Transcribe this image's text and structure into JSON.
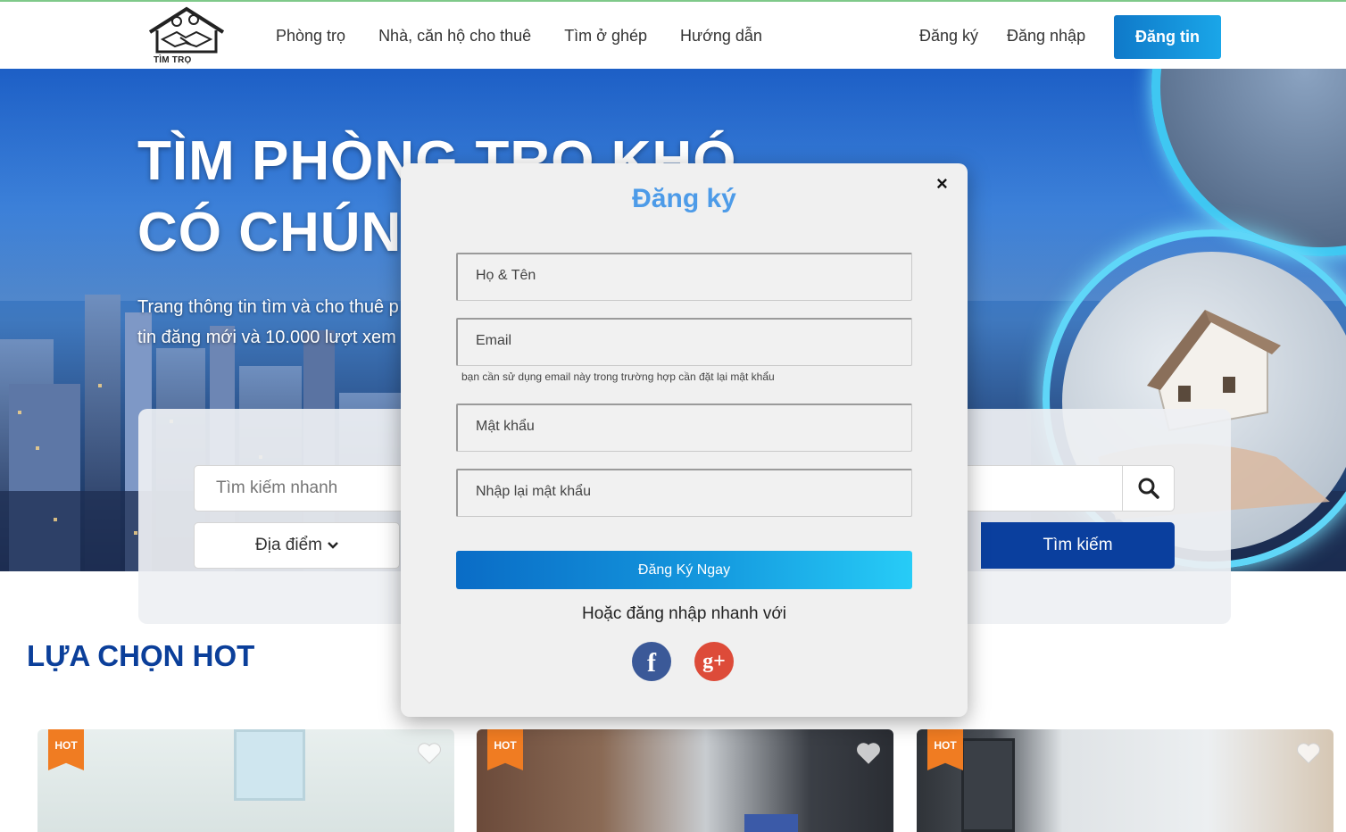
{
  "header": {
    "logo_text": "TÌM TRỌ",
    "nav": [
      "Phòng trọ",
      "Nhà, căn hộ cho thuê",
      "Tìm ở ghép",
      "Hướng dẫn"
    ],
    "register_link": "Đăng ký",
    "login_link": "Đăng nhập",
    "post_button": "Đăng tin"
  },
  "hero": {
    "title_line1": "TÌM PHÒNG TRỌ KHÓ",
    "title_line2": "CÓ CHÚNG",
    "subtitle_line1": "Trang thông tin tìm và cho thuê p",
    "subtitle_line2": "tin đăng mới và 10.000 lượt xem"
  },
  "search": {
    "placeholder": "Tìm kiếm nhanh",
    "location_label": "Địa điểm",
    "search_button": "Tìm kiếm"
  },
  "hot_section": {
    "title": "LỰA CHỌN HOT",
    "badge": "HOT"
  },
  "modal": {
    "title": "Đăng ký",
    "close_symbol": "×",
    "fullname_placeholder": "Họ & Tên",
    "email_placeholder": "Email",
    "email_hint": "bạn cần sử dụng email này trong trường hợp cần đặt lại mật khẩu",
    "password_placeholder": "Mật khẩu",
    "confirm_password_placeholder": "Nhập lại mật khẩu",
    "submit_label": "Đăng Ký Ngay",
    "or_text": "Hoặc đăng nhập nhanh với",
    "facebook_glyph": "f",
    "google_glyph": "g+"
  },
  "colors": {
    "brand_blue": "#0b3f9a",
    "accent_blue": "#4d9be8",
    "hot_orange": "#f07c22",
    "facebook": "#3b5998",
    "google": "#dd4b39"
  }
}
